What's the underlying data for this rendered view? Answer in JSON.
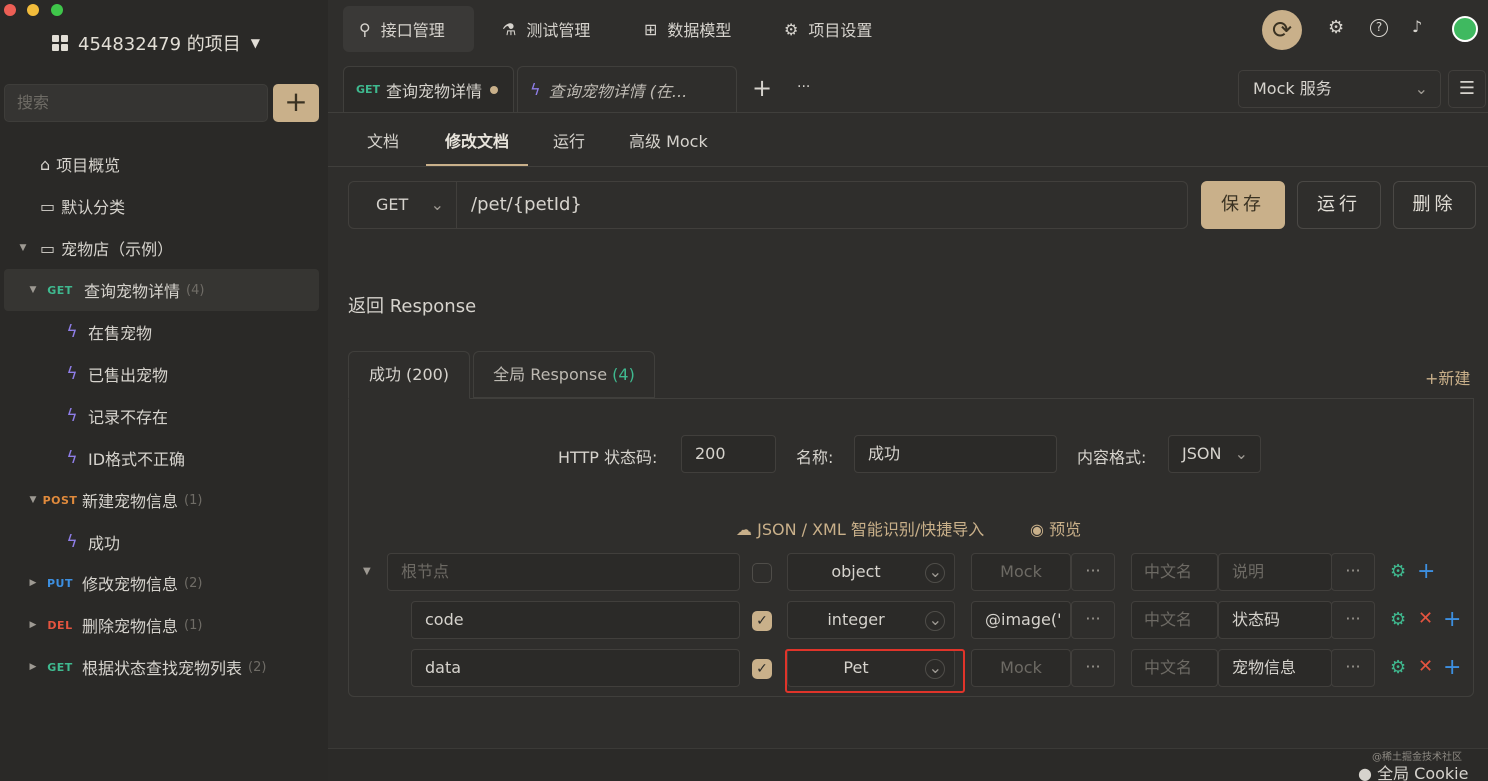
{
  "project": {
    "name": "454832479 的项目"
  },
  "sidebar": {
    "search_placeholder": "搜索",
    "add": "+",
    "items": [
      {
        "label": "项目概览",
        "icon": "bank-icon"
      },
      {
        "label": "默认分类",
        "icon": "folder-icon"
      },
      {
        "label": "宠物店（示例）",
        "icon": "folder-icon"
      },
      {
        "method": "GET",
        "label": "查询宠物详情",
        "count": "(4)",
        "method_color": "#3fb98f"
      },
      {
        "label": "在售宠物"
      },
      {
        "label": "已售出宠物"
      },
      {
        "label": "记录不存在"
      },
      {
        "label": "ID格式不正确"
      },
      {
        "method": "POST",
        "label": "新建宠物信息",
        "count": "(1)",
        "method_color": "#e08a3c"
      },
      {
        "label": "成功"
      },
      {
        "method": "PUT",
        "label": "修改宠物信息",
        "count": "(2)",
        "method_color": "#3d8fe0"
      },
      {
        "method": "DEL",
        "label": "删除宠物信息",
        "count": "(1)",
        "method_color": "#e5543f"
      },
      {
        "method": "GET",
        "label": "根据状态查找宠物列表",
        "count": "(2)",
        "method_color": "#3fb98f"
      }
    ]
  },
  "topnav": {
    "items": [
      "接口管理",
      "测试管理",
      "数据模型",
      "项目设置"
    ]
  },
  "tabs": {
    "tab1_method": "GET",
    "tab1_label": "查询宠物详情",
    "tab2_label": "查询宠物详情 (在...",
    "plus": "+",
    "more": "···",
    "mock_select": "Mock 服务"
  },
  "subtabs": [
    "文档",
    "修改文档",
    "运行",
    "高级 Mock"
  ],
  "request": {
    "method": "GET",
    "url": "/pet/{petId}",
    "save": "保存",
    "run": "运行",
    "delete": "删除"
  },
  "response": {
    "title": "返回 Response",
    "tab1": "成功 (200)",
    "tab2_label": "全局 Response",
    "tab2_count": "(4)",
    "new": "+新建",
    "status_label": "HTTP 状态码:",
    "status_value": "200",
    "name_label": "名称:",
    "name_value": "成功",
    "format_label": "内容格式:",
    "format_value": "JSON",
    "import_label": "JSON / XML 智能识别/快捷导入",
    "preview_label": "预览",
    "rows": [
      {
        "name_placeholder": "根节点",
        "type": "object",
        "mock": "Mock",
        "cn": "中文名",
        "desc": "说明"
      },
      {
        "name": "code",
        "type": "integer",
        "mock": "@image('",
        "cn": "中文名",
        "desc": "状态码"
      },
      {
        "name": "data",
        "type": "Pet",
        "mock": "Mock",
        "cn": "中文名",
        "desc": "宠物信息"
      }
    ]
  },
  "footer": {
    "cookie": "全局 Cookie",
    "watermark": "@稀土掘金技术社区"
  },
  "colors": {
    "accent": "#c9b08a",
    "highlight": "#e0342a",
    "get": "#3fb98f",
    "post": "#e08a3c",
    "put": "#3d8fe0",
    "del": "#e5543f"
  }
}
